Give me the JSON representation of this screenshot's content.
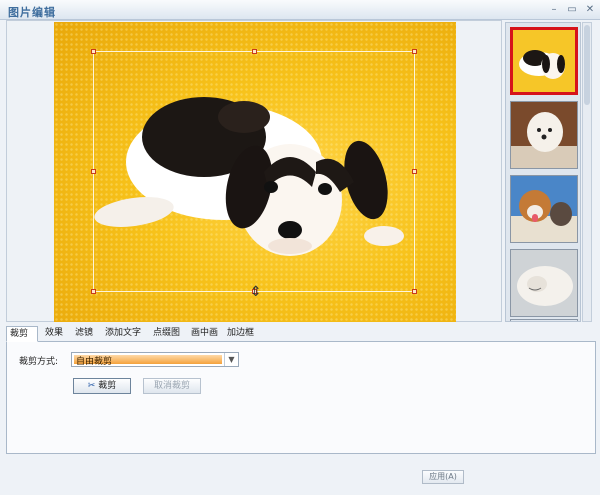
{
  "window": {
    "title": "图片编辑",
    "buttons": {
      "minimize": "–",
      "maximize": "▭",
      "close": "✕"
    }
  },
  "thumbnails": [
    {
      "name": "puppy-black-white",
      "selected": true
    },
    {
      "name": "white-dog",
      "selected": false
    },
    {
      "name": "puppy-and-cat",
      "selected": false
    },
    {
      "name": "sleeping-white-dog",
      "selected": false
    }
  ],
  "tabs": [
    "裁剪",
    "效果",
    "滤镜",
    "添加文字",
    "点缀图",
    "画中画",
    "加边框"
  ],
  "crop": {
    "mode_label": "裁剪方式:",
    "mode_value": "自由裁剪",
    "crop_button": "裁剪",
    "cancel_button": "取消裁剪"
  },
  "footer": {
    "apply_button": "应用(A)"
  },
  "colors": {
    "accent": "#d6131a",
    "title": "#3f6e9e"
  }
}
